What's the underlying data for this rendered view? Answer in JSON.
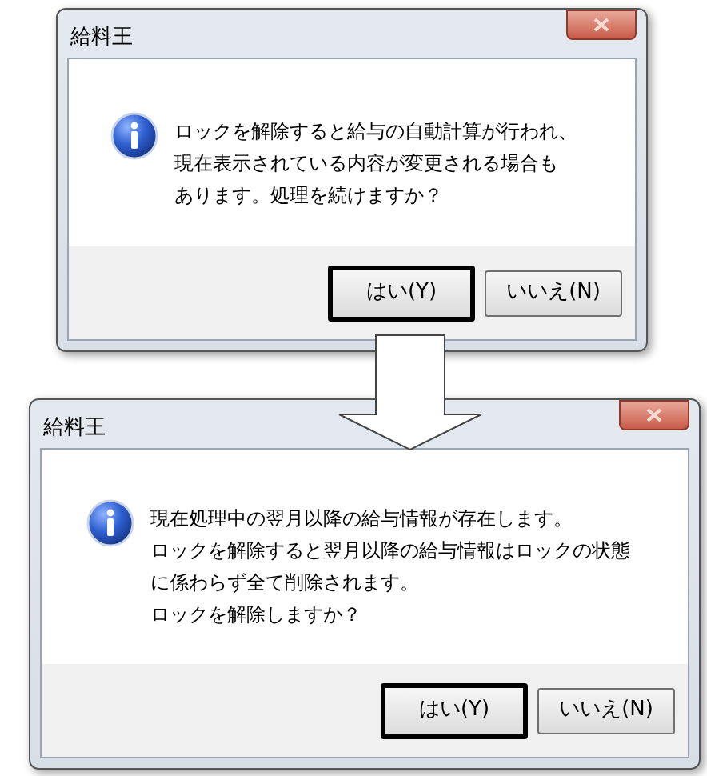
{
  "dialogs": [
    {
      "title": "給料王",
      "message_lines": [
        "ロックを解除すると給与の自動計算が行われ、",
        "現在表示されている内容が変更される場合も",
        "あります。処理を続けますか？"
      ],
      "buttons": [
        {
          "label": "はい(Y)",
          "highlighted": true
        },
        {
          "label": "いいえ(N)",
          "highlighted": false
        }
      ]
    },
    {
      "title": "給料王",
      "message_lines": [
        "現在処理中の翌月以降の給与情報が存在します。",
        "ロックを解除すると翌月以降の給与情報はロックの状態",
        "に係わらず全て削除されます。",
        "ロックを解除しますか？"
      ],
      "buttons": [
        {
          "label": "はい(Y)",
          "highlighted": true
        },
        {
          "label": "いいえ(N)",
          "highlighted": false
        }
      ]
    }
  ]
}
